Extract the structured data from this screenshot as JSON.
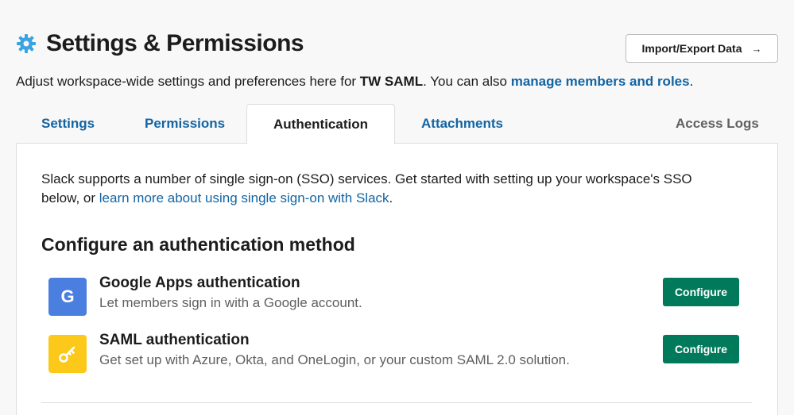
{
  "header": {
    "title": "Settings & Permissions",
    "icon": "gear-icon",
    "icon_color": "#3aa3e3"
  },
  "import_button": {
    "label": "Import/Export Data",
    "arrow": "→"
  },
  "subtitle": {
    "prefix": "Adjust workspace-wide settings and preferences here for ",
    "workspace": "TW SAML",
    "middle": ". You can also ",
    "link": "manage members and roles",
    "suffix": "."
  },
  "tabs": [
    {
      "label": "Settings",
      "active": false
    },
    {
      "label": "Permissions",
      "active": false
    },
    {
      "label": "Authentication",
      "active": true
    },
    {
      "label": "Attachments",
      "active": false
    },
    {
      "label": "Access Logs",
      "active": false
    }
  ],
  "intro": {
    "text": "Slack supports a number of single sign-on (SSO) services. Get started with setting up your workspace's SSO below, or ",
    "link": "learn more about using single sign-on with Slack",
    "suffix": "."
  },
  "section_title": "Configure an authentication method",
  "methods": [
    {
      "icon_letter": "G",
      "title": "Google Apps authentication",
      "description": "Let members sign in with a Google account.",
      "button": "Configure"
    },
    {
      "icon": "key-icon",
      "title": "SAML authentication",
      "description": "Get set up with Azure, Okta, and OneLogin, or your custom SAML 2.0 solution.",
      "button": "Configure"
    }
  ],
  "colors": {
    "link": "#1264a3",
    "primary_button": "#007a5a",
    "google_blue": "#4a7fe0",
    "key_yellow": "#fcc91a"
  }
}
